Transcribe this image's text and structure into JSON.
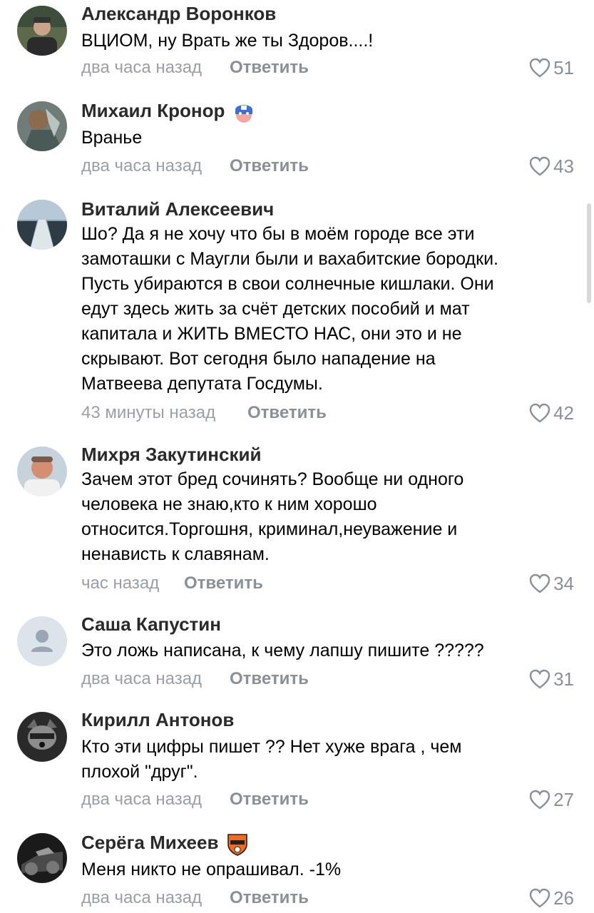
{
  "comments": [
    {
      "author": "Александр Воронков",
      "lines": [
        "ВЦИОМ, ну Врать же ты Здоров....!"
      ],
      "time": "два часа назад",
      "reply": "Ответить",
      "likes": "51",
      "avatar": "photo-avatar",
      "badge": ""
    },
    {
      "author": "Михаил Кронор",
      "lines": [
        "Вранье"
      ],
      "time": "два часа назад",
      "reply": "Ответить",
      "likes": "43",
      "avatar": "photo-avatar",
      "badge": "hero-mask-badge"
    },
    {
      "author": "Виталий Алексеевич",
      "lines": [
        "Шо? Да я не хочу что бы в моём городе все эти",
        "замоташки с Маугли были и вахабитские бородки.",
        "Пусть убираются в свои солнечные кишлаки. Они",
        "едут здесь жить за счёт детских пособий и мат",
        "капитала и ЖИТЬ ВМЕСТО НАС, они это и не",
        "скрывают. Вот сегодня было нападение на",
        "Матвеева депутата Госдумы."
      ],
      "time": "43 минуты назад",
      "reply": "Ответить",
      "likes": "42",
      "avatar": "photo-avatar",
      "badge": ""
    },
    {
      "author": "Михря Закутинский",
      "lines": [
        "Зачем этот бред сочинять? Вообще ни одного",
        "человека не знаю,кто к ним хорошо",
        "относится.Торгошня, криминал,неуважение и",
        "ненависть к славянам."
      ],
      "time": "час назад",
      "reply": "Ответить",
      "likes": "34",
      "avatar": "photo-avatar",
      "badge": ""
    },
    {
      "author": "Саша Капустин",
      "lines": [
        "Это ложь написана, к чему лапшу пишите ?????"
      ],
      "time": "два часа назад",
      "reply": "Ответить",
      "likes": "31",
      "avatar": "default-avatar",
      "badge": ""
    },
    {
      "author": "Кирилл Антонов",
      "lines": [
        "Кто эти цифры пишет ??  Нет хуже врага , чем",
        "плохой \"друг\"."
      ],
      "time": "два часа назад",
      "reply": "Ответить",
      "likes": "27",
      "avatar": "photo-avatar",
      "badge": ""
    },
    {
      "author": "Серёга Михеев",
      "lines": [
        "Меня никто не опрашивал. -1%"
      ],
      "time": "два часа назад",
      "reply": "Ответить",
      "likes": "26",
      "avatar": "photo-avatar",
      "badge": "club-shield-badge"
    }
  ],
  "colors": {
    "meta": "#9a9fa6",
    "reply": "#8a9098",
    "author": "#2a2a2a"
  }
}
